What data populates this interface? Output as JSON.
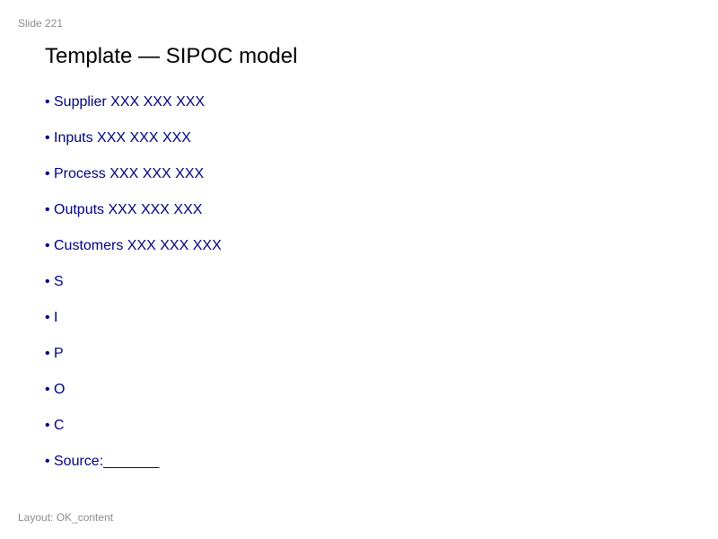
{
  "slide": {
    "number_label": "Slide 221",
    "title": "Template — SIPOC model",
    "bullets": [
      "Supplier XXX XXX XXX",
      "Inputs XXX XXX XXX",
      "Process XXX XXX XXX",
      "Outputs XXX XXX XXX",
      "Customers XXX XXX XXX",
      "S",
      "I",
      "P",
      "O",
      "C",
      "Source:_______"
    ],
    "bullet_glyph": "•",
    "layout_label": "Layout: OK_content"
  },
  "colors": {
    "bullet_text": "#000080",
    "title_text": "#000000",
    "meta_text": "#8c8c8c",
    "background": "#ffffff"
  }
}
